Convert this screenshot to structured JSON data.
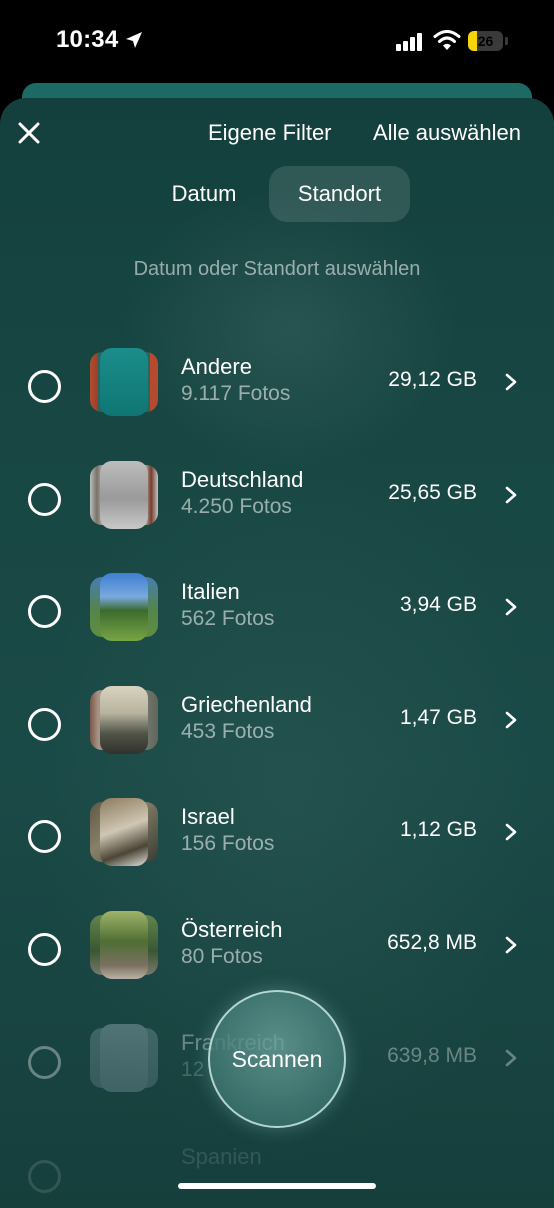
{
  "status": {
    "time": "10:34",
    "battery": "26",
    "battery_level": 0.26
  },
  "header": {
    "close_icon": "close-icon",
    "custom_filter": "Eigene Filter",
    "select_all": "Alle auswählen"
  },
  "tabs": [
    {
      "label": "Datum",
      "active": false
    },
    {
      "label": "Standort",
      "active": true
    }
  ],
  "hint": "Datum oder Standort auswählen",
  "locations": [
    {
      "name": "Andere",
      "count": "9.117 Fotos",
      "size": "29,12 GB"
    },
    {
      "name": "Deutschland",
      "count": "4.250 Fotos",
      "size": "25,65 GB"
    },
    {
      "name": "Italien",
      "count": "562 Fotos",
      "size": "3,94 GB"
    },
    {
      "name": "Griechenland",
      "count": "453 Fotos",
      "size": "1,47 GB"
    },
    {
      "name": "Israel",
      "count": "156 Fotos",
      "size": "1,12 GB"
    },
    {
      "name": "Österreich",
      "count": "80 Fotos",
      "size": "652,8 MB"
    },
    {
      "name": "Frankreich",
      "count": "12",
      "size": "639,8 MB"
    },
    {
      "name": "Spanien",
      "count": "",
      "size": ""
    }
  ],
  "scan_button": "Scannen"
}
